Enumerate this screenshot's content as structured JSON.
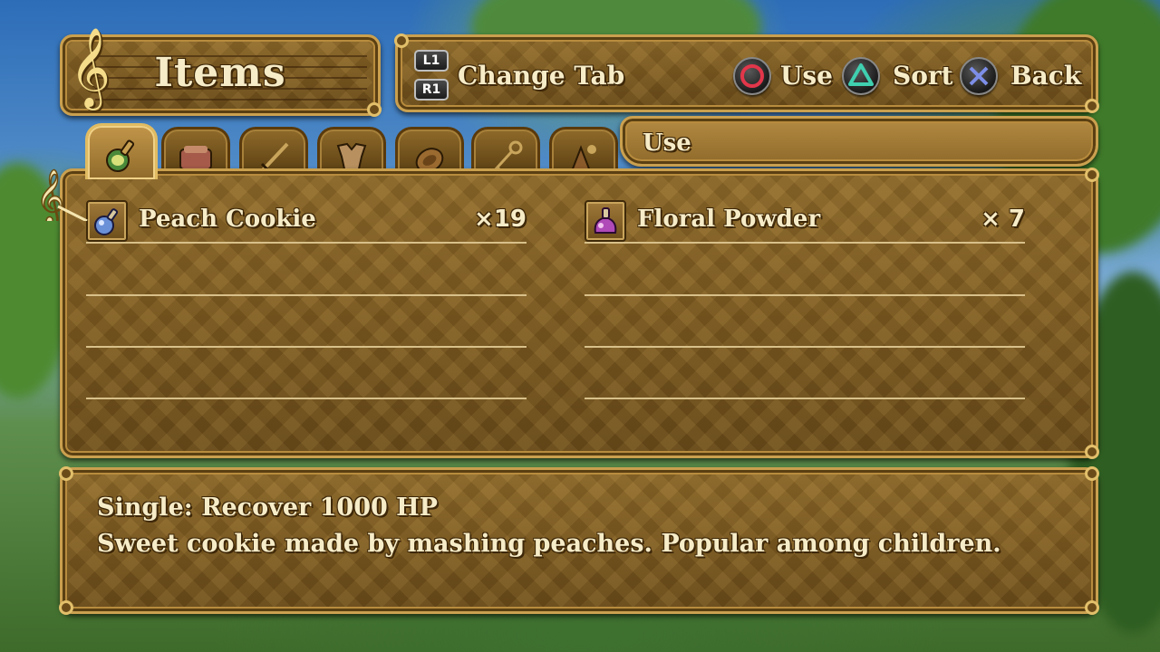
{
  "title": "Items",
  "controls": {
    "l1": "L1",
    "r1": "R1",
    "change_tab": "Change Tab",
    "use": "Use",
    "sort": "Sort",
    "back": "Back"
  },
  "tabs": [
    {
      "icon": "potion-icon",
      "active": true
    },
    {
      "icon": "scroll-icon",
      "active": false
    },
    {
      "icon": "sword-icon",
      "active": false
    },
    {
      "icon": "armor-icon",
      "active": false
    },
    {
      "icon": "shield-icon",
      "active": false
    },
    {
      "icon": "key-icon",
      "active": false
    },
    {
      "icon": "misc-icon",
      "active": false
    }
  ],
  "category": "Use",
  "items": [
    {
      "name": "Peach Cookie",
      "qty": "×19",
      "icon": "blue-potion-icon",
      "selected": true
    },
    {
      "name": "Floral Powder",
      "qty": "×  7",
      "icon": "purple-potion-icon",
      "selected": false
    }
  ],
  "description": {
    "line1": "Single: Recover 1000 HP",
    "line2": "Sweet cookie made by mashing peaches. Popular among children."
  },
  "colors": {
    "panel": "#7d5a20",
    "border": "#caa04f",
    "text": "#f7ecc8",
    "circle_button": "#e2364a",
    "triangle_button": "#3fd0b0",
    "cross_button": "#7d8ee8"
  }
}
